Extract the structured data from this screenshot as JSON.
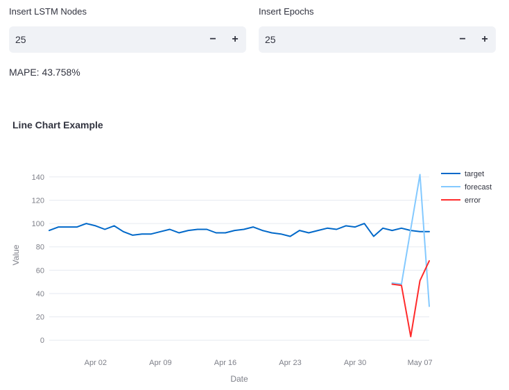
{
  "inputs": [
    {
      "label": "Insert LSTM Nodes",
      "value": "25",
      "minus": "−",
      "plus": "+"
    },
    {
      "label": "Insert Epochs",
      "value": "25",
      "minus": "−",
      "plus": "+"
    }
  ],
  "metric": {
    "text": "MAPE: 43.758%"
  },
  "chart": {
    "title": "Line Chart Example"
  },
  "chart_data": {
    "type": "line",
    "xlabel": "Date",
    "ylabel": "Value",
    "ylim": [
      -10,
      150
    ],
    "xlim": [
      "2025-03-28",
      "2025-05-08"
    ],
    "yticks": [
      0,
      20,
      40,
      60,
      80,
      100,
      120,
      140
    ],
    "xticks": [
      {
        "date": "2025-04-02",
        "label": "Apr 02"
      },
      {
        "date": "2025-04-09",
        "label": "Apr 09"
      },
      {
        "date": "2025-04-16",
        "label": "Apr 16"
      },
      {
        "date": "2025-04-23",
        "label": "Apr 23"
      },
      {
        "date": "2025-04-30",
        "label": "Apr 30"
      },
      {
        "date": "2025-05-07",
        "label": "May 07"
      }
    ],
    "grid": true,
    "legend": "right",
    "series": [
      {
        "name": "target",
        "color": "#0068c9",
        "x": [
          "2025-03-28",
          "2025-03-29",
          "2025-03-30",
          "2025-03-31",
          "2025-04-01",
          "2025-04-02",
          "2025-04-03",
          "2025-04-04",
          "2025-04-05",
          "2025-04-06",
          "2025-04-07",
          "2025-04-08",
          "2025-04-09",
          "2025-04-10",
          "2025-04-11",
          "2025-04-12",
          "2025-04-13",
          "2025-04-14",
          "2025-04-15",
          "2025-04-16",
          "2025-04-17",
          "2025-04-18",
          "2025-04-19",
          "2025-04-20",
          "2025-04-21",
          "2025-04-22",
          "2025-04-23",
          "2025-04-24",
          "2025-04-25",
          "2025-04-26",
          "2025-04-27",
          "2025-04-28",
          "2025-04-29",
          "2025-04-30",
          "2025-05-01",
          "2025-05-02",
          "2025-05-03",
          "2025-05-04",
          "2025-05-05",
          "2025-05-06",
          "2025-05-07",
          "2025-05-08"
        ],
        "y": [
          94,
          97,
          97,
          97,
          100,
          98,
          95,
          98,
          93,
          90,
          91,
          91,
          93,
          95,
          92,
          94,
          95,
          95,
          92,
          92,
          94,
          95,
          97,
          94,
          92,
          91,
          89,
          94,
          92,
          94,
          96,
          95,
          98,
          97,
          100,
          89,
          96,
          94,
          96,
          94,
          93,
          93
        ]
      },
      {
        "name": "forecast",
        "color": "#83c9ff",
        "x": [
          "2025-05-04",
          "2025-05-05",
          "2025-05-07",
          "2025-05-08"
        ],
        "y": [
          49,
          48,
          142,
          29
        ]
      },
      {
        "name": "error",
        "color": "#ff2b2b",
        "x": [
          "2025-05-04",
          "2025-05-05",
          "2025-05-06",
          "2025-05-07",
          "2025-05-08"
        ],
        "y": [
          48,
          47,
          3,
          51,
          68
        ]
      }
    ]
  }
}
